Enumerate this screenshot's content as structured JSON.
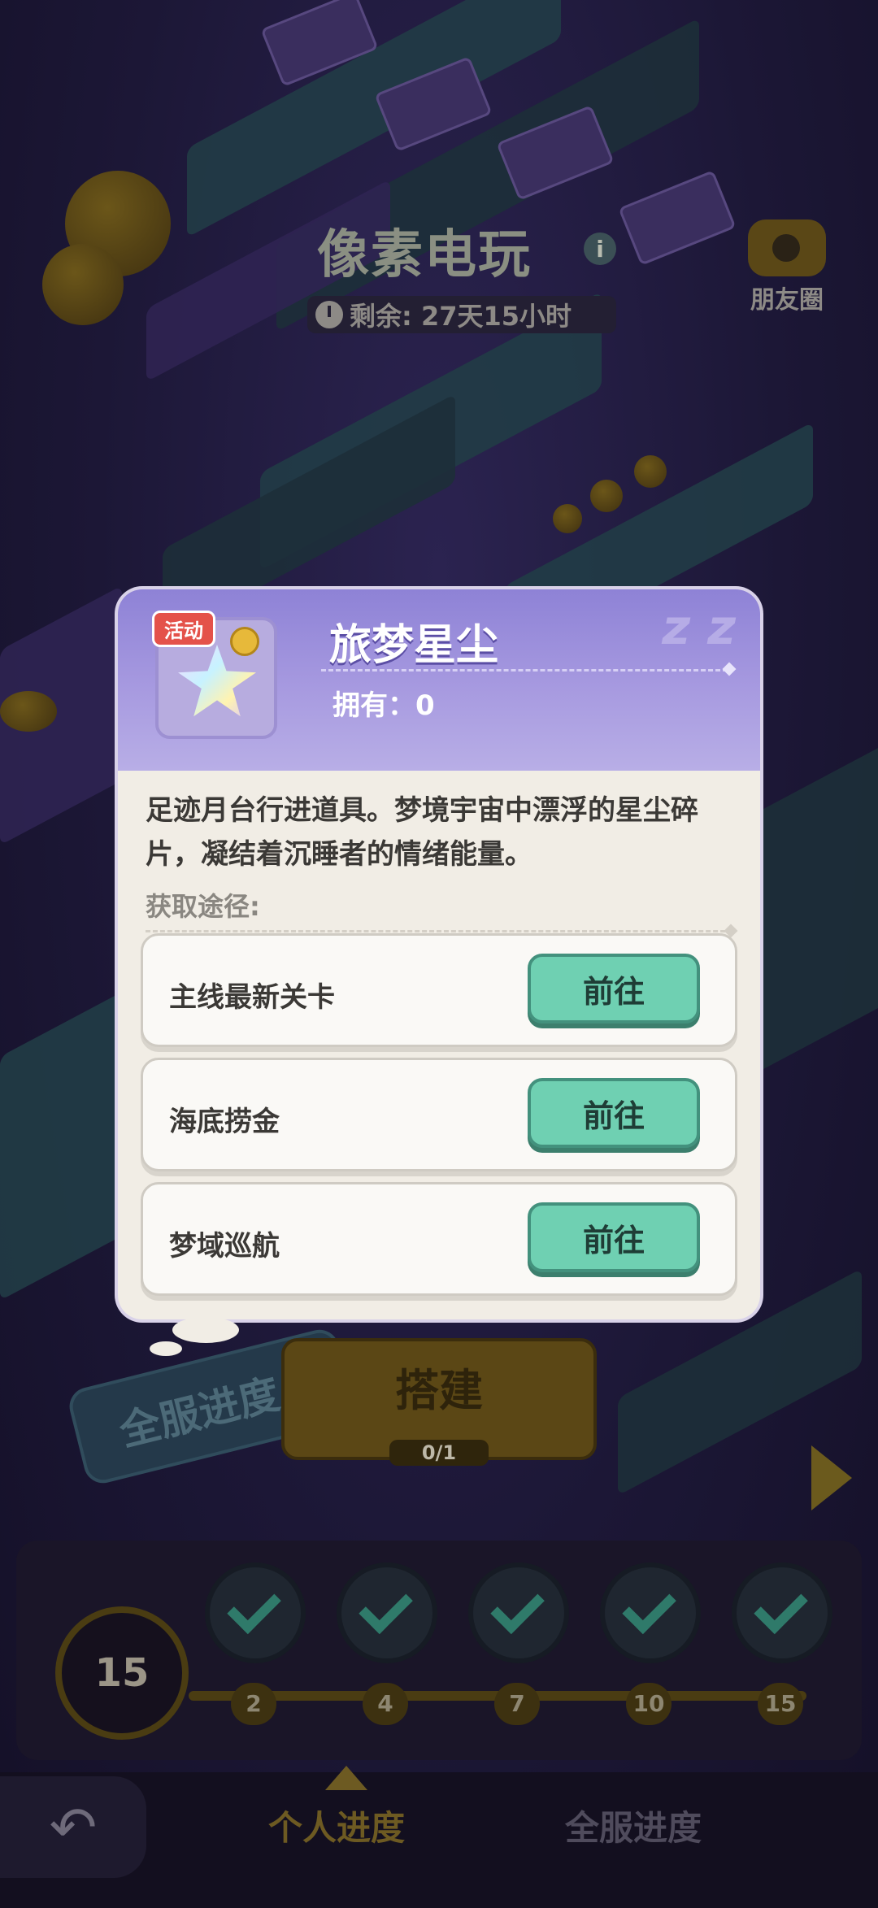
{
  "event": {
    "title": "像素电玩",
    "info_icon": "i",
    "timer": "剩余: 27天15小时"
  },
  "friends": {
    "label": "朋友圈",
    "icon": "camera-icon"
  },
  "popup": {
    "tag": "活动",
    "item_name": "旅梦星尘",
    "owned": "拥有：0",
    "description": "足迹月台行进道具。梦境宇宙中漂浮的星尘碎片，凝结着沉睡者的情绪能量。",
    "sources_label": "获取途径:",
    "sources": [
      {
        "name": "主线最新关卡",
        "button": "前往"
      },
      {
        "name": "海底捞金",
        "button": "前往"
      },
      {
        "name": "梦域巡航",
        "button": "前往"
      }
    ]
  },
  "build": {
    "label": "搭建",
    "count": "0/1"
  },
  "server_progress_pill": "全服进度",
  "level": "15",
  "milestones": [
    "2",
    "4",
    "7",
    "10",
    "15"
  ],
  "nav": {
    "back_icon": "↶",
    "tab_personal": "个人进度",
    "tab_server": "全服进度"
  },
  "colors": {
    "accent_green": "#6fd0b2",
    "header_purple": "#8e82d6",
    "tag_red": "#e4524a"
  }
}
